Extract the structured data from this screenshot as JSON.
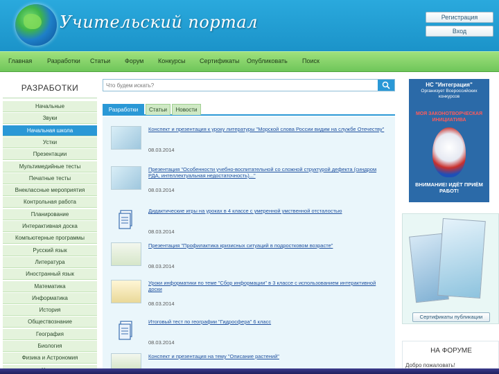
{
  "header": {
    "logo_text": "Учительский портал",
    "register_label": "Регистрация",
    "login_label": "Вход"
  },
  "nav": {
    "items": [
      "Главная",
      "Разработки",
      "Статьи",
      "Форум",
      "Конкурсы",
      "Сертификаты",
      "Опубликовать",
      "Поиск"
    ]
  },
  "sidebar": {
    "title": "РАЗРАБОТКИ",
    "items": [
      "Начальные",
      "Звуки",
      "Начальная школа",
      "Устки",
      "Презентации",
      "Мультимедийные тесты",
      "Печатные тесты",
      "Внеклассные мероприятия",
      "Контрольная работа",
      "Планирование",
      "Интерактивная доска",
      "Компьютерные программы",
      "Русский язык",
      "Литература",
      "Иностранный язык",
      "Математика",
      "Информатика",
      "История",
      "Обществознание",
      "География",
      "Биология",
      "Физика и Астрономия",
      "Химия"
    ],
    "active_index": 2
  },
  "search": {
    "placeholder": "Что будем искать?"
  },
  "tabs": [
    "Разработки",
    "Статьи",
    "Новости"
  ],
  "entries": [
    {
      "title": "Конспект и презентация к уроку литературы \"Морской слова России видим на службе Отечеству\"",
      "date": "08.03.2014"
    },
    {
      "title": "Презентация \"Особенности учебно-воспитательной со сложной структурой дефекта (синдром РДА, интеллектуальная недостаточность)...\"",
      "date": "08.03.2014"
    },
    {
      "title": "Дидактические игры на уроках в 4 классе с умеренной умственной отсталостью",
      "date": "08.03.2014"
    },
    {
      "title": "Презентация \"Профилактика кризисных ситуаций в подростковом возрасте\"",
      "date": "08.03.2014"
    },
    {
      "title": "Уроки информатики по теме \"Сбор информации\" в 3 классе с использованием интерактивной доски",
      "date": "08.03.2014"
    },
    {
      "title": "Итоговый тест по географии \"Гидросфера\" 6 класс",
      "date": "08.03.2014"
    },
    {
      "title": "Конспект и презентация на тему \"Описание растений\"",
      "date": ""
    }
  ],
  "promo": {
    "title": "НС \"Интеграция\"",
    "subtitle": "Организует Всероссийских конкурсов",
    "headline": "МОЯ ЗАКОНОТВОРЧЕСКАЯ ИНИЦИАТИВА",
    "attention": "ВНИМАНИЕ! ИДЁТ ПРИЁМ РАБОТ!"
  },
  "certs": {
    "button_label": "Сертификаты публикации"
  },
  "forum": {
    "title": "НА ФОРУМЕ",
    "line": "Добро пожаловать!"
  }
}
